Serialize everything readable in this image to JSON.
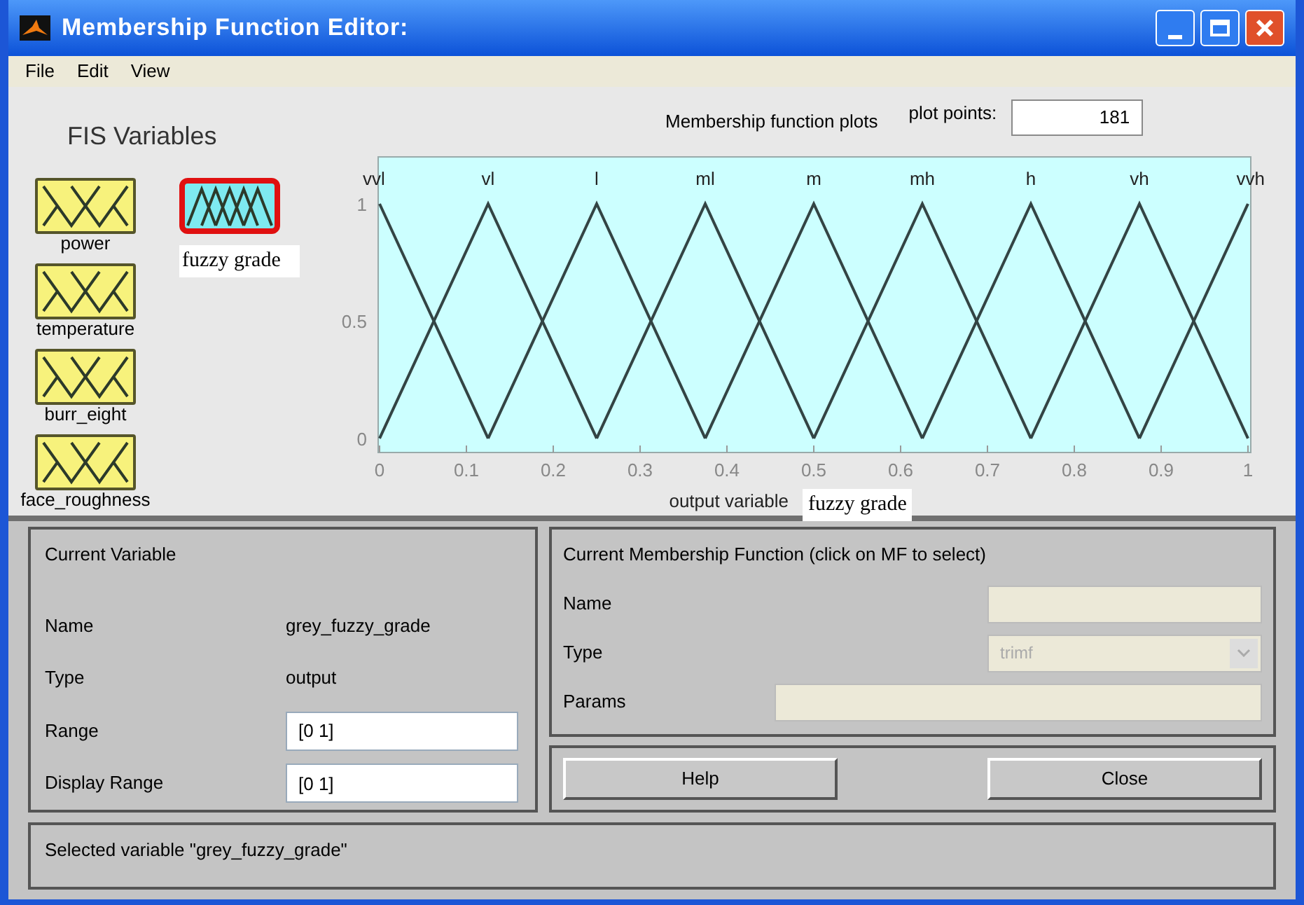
{
  "window": {
    "title": "Membership Function Editor:"
  },
  "menu": [
    "File",
    "Edit",
    "View"
  ],
  "fis_variables": {
    "title": "FIS Variables",
    "inputs": [
      {
        "label": "power",
        "selected": false
      },
      {
        "label": "temperature",
        "selected": false
      },
      {
        "label": "burr_eight",
        "selected": false
      },
      {
        "label": "face_roughness",
        "selected": false
      }
    ],
    "outputs": [
      {
        "label": "fuzzy grade",
        "selected": true
      }
    ]
  },
  "plot": {
    "title": "Membership function plots",
    "plot_points_label": "plot points:",
    "plot_points": "181",
    "variable_label": "fuzzy grade",
    "chart_data": {
      "type": "line",
      "xlabel": "output variable",
      "x": [
        0,
        0.125,
        0.25,
        0.375,
        0.5,
        0.625,
        0.75,
        0.875,
        1
      ],
      "xlim": [
        0,
        1
      ],
      "ylim": [
        -0.06,
        1.2
      ],
      "xticks": [
        0,
        0.1,
        0.2,
        0.3,
        0.4,
        0.5,
        0.6,
        0.7,
        0.8,
        0.9,
        1
      ],
      "yticks": [
        0,
        0.5,
        1
      ],
      "series": [
        {
          "name": "vvl",
          "color": "#334444",
          "values": [
            1,
            0,
            null,
            null,
            null,
            null,
            null,
            null,
            null
          ]
        },
        {
          "name": "vl",
          "color": "#334444",
          "values": [
            0,
            1,
            0,
            null,
            null,
            null,
            null,
            null,
            null
          ]
        },
        {
          "name": "l",
          "color": "#334444",
          "values": [
            null,
            0,
            1,
            0,
            null,
            null,
            null,
            null,
            null
          ]
        },
        {
          "name": "ml",
          "color": "#334444",
          "values": [
            null,
            null,
            0,
            1,
            0,
            null,
            null,
            null,
            null
          ]
        },
        {
          "name": "m",
          "color": "#334444",
          "values": [
            null,
            null,
            null,
            0,
            1,
            0,
            null,
            null,
            null
          ]
        },
        {
          "name": "mh",
          "color": "#334444",
          "values": [
            null,
            null,
            null,
            null,
            0,
            1,
            0,
            null,
            null
          ]
        },
        {
          "name": "h",
          "color": "#334444",
          "values": [
            null,
            null,
            null,
            null,
            null,
            0,
            1,
            0,
            null
          ]
        },
        {
          "name": "vh",
          "color": "#334444",
          "values": [
            null,
            null,
            null,
            null,
            null,
            null,
            0,
            1,
            0
          ]
        },
        {
          "name": "vvh",
          "color": "#334444",
          "values": [
            null,
            null,
            null,
            null,
            null,
            null,
            null,
            0,
            1
          ]
        }
      ]
    }
  },
  "current_variable": {
    "title": "Current Variable",
    "fields": [
      {
        "label": "Name",
        "value": "grey_fuzzy_grade",
        "kind": "text"
      },
      {
        "label": "Type",
        "value": "output",
        "kind": "text"
      },
      {
        "label": "Range",
        "value": "[0 1]",
        "kind": "input"
      },
      {
        "label": "Display Range",
        "value": "[0 1]",
        "kind": "input"
      }
    ]
  },
  "current_mf": {
    "title": "Current Membership Function (click on MF to select)",
    "fields": [
      {
        "label": "Name",
        "kind": "input"
      },
      {
        "label": "Type",
        "value": "trimf",
        "kind": "select"
      },
      {
        "label": "Params",
        "kind": "wide"
      }
    ]
  },
  "buttons": [
    "Help",
    "Close"
  ],
  "status": "Selected variable \"grey_fuzzy_grade\""
}
